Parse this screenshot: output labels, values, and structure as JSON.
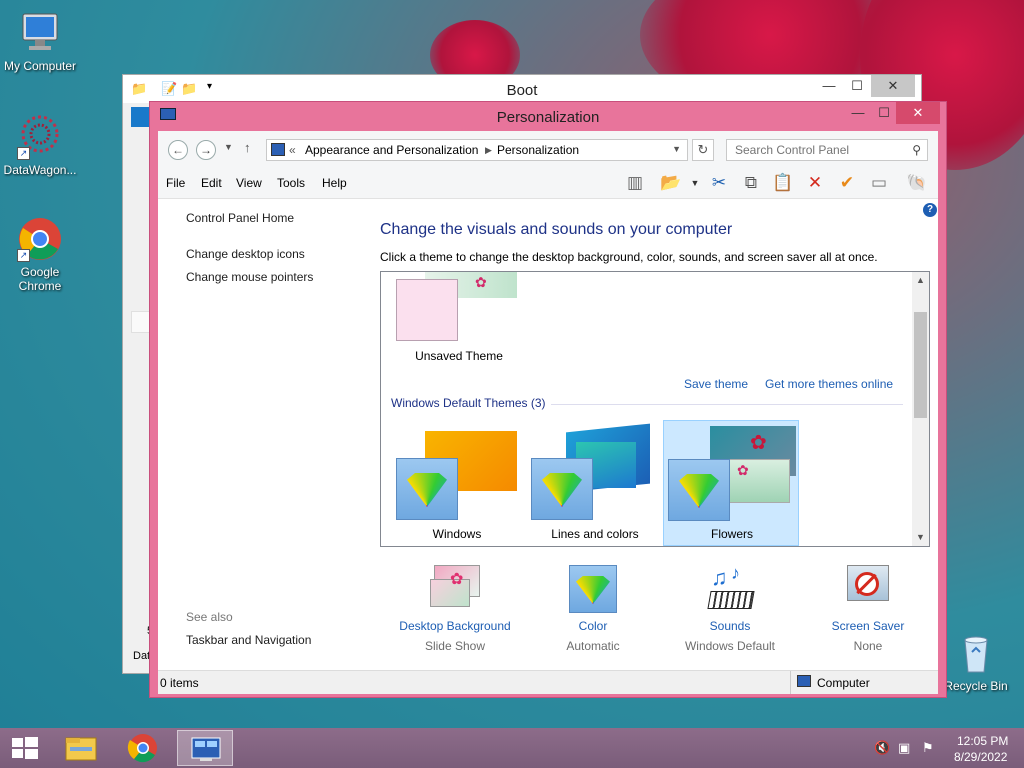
{
  "desktop": {
    "icons": [
      {
        "label": "My Computer",
        "icon": "computer-icon"
      },
      {
        "label": "DataWagon...",
        "icon": "datawagon-icon"
      },
      {
        "label": "Google Chrome",
        "icon": "chrome-icon"
      },
      {
        "label": "Recycle Bin",
        "icon": "recycle-bin-icon"
      }
    ]
  },
  "boot_window": {
    "title": "Boot",
    "side_labels": [
      "5",
      "Dat"
    ]
  },
  "window": {
    "title": "Personalization",
    "breadcrumb": [
      "«",
      "Appearance and Personalization",
      "Personalization"
    ],
    "search_placeholder": "Search Control Panel",
    "menu": [
      "File",
      "Edit",
      "View",
      "Tools",
      "Help"
    ],
    "left_links": [
      "Control Panel Home",
      "Change desktop icons",
      "Change mouse pointers"
    ],
    "see_also_label": "See also",
    "see_also_links": [
      "Taskbar and Navigation"
    ],
    "main_title": "Change the visuals and sounds on your computer",
    "main_description": "Click a theme to change the desktop background, color, sounds, and screen saver all at once.",
    "unsaved_theme_label": "Unsaved Theme",
    "save_theme_link": "Save theme",
    "get_more_link": "Get more themes online",
    "group_header": "Windows Default Themes (3)",
    "themes": [
      {
        "name": "Windows",
        "selected": false
      },
      {
        "name": "Lines and colors",
        "selected": false
      },
      {
        "name": "Flowers",
        "selected": true
      }
    ],
    "bottom_items": [
      {
        "label": "Desktop Background",
        "value": "Slide Show"
      },
      {
        "label": "Color",
        "value": "Automatic"
      },
      {
        "label": "Sounds",
        "value": "Windows Default"
      },
      {
        "label": "Screen Saver",
        "value": "None"
      }
    ],
    "status_items": "0 items",
    "status_location": "Computer"
  },
  "taskbar": {
    "time": "12:05 PM",
    "date": "8/29/2022"
  },
  "colors": {
    "window_frame": "#e8749b",
    "link_blue": "#1e5eb3",
    "heading_blue": "#1e3287",
    "selected_theme_bg": "#cce8ff"
  }
}
